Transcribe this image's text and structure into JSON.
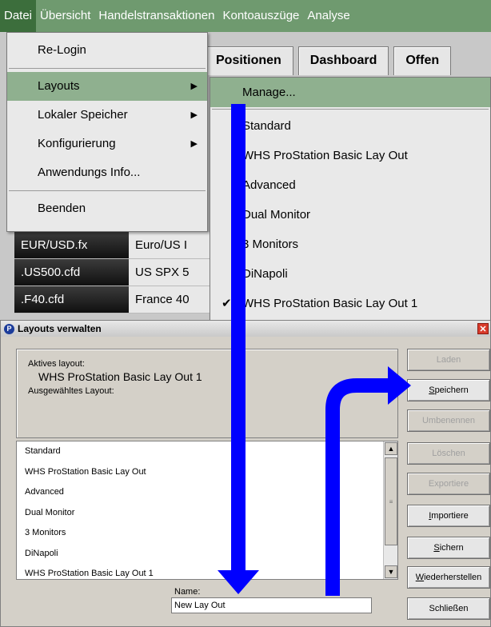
{
  "menubar": {
    "items": [
      "Datei",
      "Übersicht",
      "Handelstransaktionen",
      "Kontoauszüge",
      "Analyse"
    ]
  },
  "tabs": [
    "Positionen",
    "Dashboard",
    "Offen"
  ],
  "quotes": [
    {
      "symbol": "EUR/USD.fx",
      "name": "Euro/US I"
    },
    {
      "symbol": ".US500.cfd",
      "name": "US SPX 5"
    },
    {
      "symbol": ".F40.cfd",
      "name": "France 40"
    }
  ],
  "file_menu": {
    "relogin": "Re-Login",
    "layouts": "Layouts",
    "local_storage": "Lokaler Speicher",
    "configuration": "Konfigurierung",
    "app_info": "Anwendungs Info...",
    "exit": "Beenden"
  },
  "layouts_submenu": {
    "manage": "Manage...",
    "items": [
      "Standard",
      "WHS ProStation Basic Lay Out",
      "Advanced",
      "Dual Monitor",
      "3 Monitors",
      "DiNapoli",
      "WHS ProStation Basic Lay Out 1"
    ],
    "checked_index": 6
  },
  "dialog": {
    "title": "Layouts verwalten",
    "active_layout_label": "Aktives layout:",
    "active_layout_value": "WHS ProStation Basic Lay Out 1",
    "selected_layout_label": "Ausgewähltes Layout:",
    "list": [
      "Standard",
      "WHS ProStation Basic Lay Out",
      "Advanced",
      "Dual Monitor",
      "3 Monitors",
      "DiNapoli",
      "WHS ProStation Basic Lay Out 1"
    ],
    "name_label": "Name:",
    "name_value": "New Lay Out",
    "buttons": {
      "load": "Laden",
      "save": "Speichern",
      "rename": "Umbenennen",
      "delete": "Löschen",
      "export": "Exportiere",
      "import": "Importiere",
      "backup": "Sichern",
      "restore": "Wiederherstellen",
      "close": "Schließen"
    }
  },
  "colors": {
    "menubar": "#6f9a6f",
    "highlight": "#8fb08f",
    "arrow": "#0000ff"
  }
}
